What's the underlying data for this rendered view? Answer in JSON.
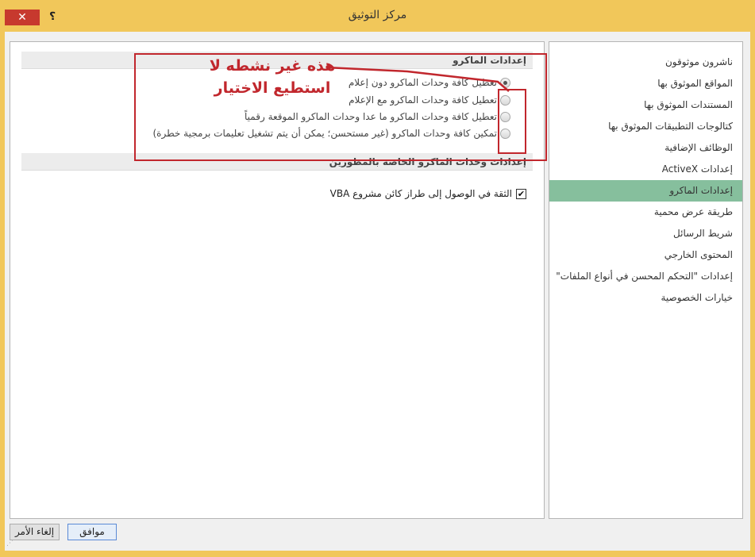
{
  "window": {
    "title": "مركز التوثيق",
    "close_glyph": "✕",
    "help_glyph": "؟"
  },
  "sidebar": {
    "items": [
      {
        "label": "ناشرون موثوقون",
        "selected": false
      },
      {
        "label": "المواقع الموثوق بها",
        "selected": false
      },
      {
        "label": "المستندات الموثوق بها",
        "selected": false
      },
      {
        "label": "كتالوجات التطبيقات الموثوق بها",
        "selected": false
      },
      {
        "label": "الوظائف الإضافية",
        "selected": false
      },
      {
        "label": "إعدادات ActiveX",
        "selected": false
      },
      {
        "label": "إعدادات الماكرو",
        "selected": true
      },
      {
        "label": "طريقة عرض محمية",
        "selected": false
      },
      {
        "label": "شريط الرسائل",
        "selected": false
      },
      {
        "label": "المحتوى الخارجي",
        "selected": false
      },
      {
        "label": "إعدادات \"التحكم المحسن في أنواع الملفات\"",
        "selected": false
      },
      {
        "label": "خيارات الخصوصية",
        "selected": false
      }
    ]
  },
  "main": {
    "macro_section_title": "إعدادات الماكرو",
    "radio_options": [
      {
        "label": "تعطيل كافة وحدات الماكرو دون إعلام",
        "checked": true
      },
      {
        "label": "تعطيل كافة وحدات الماكرو مع الإعلام",
        "checked": false
      },
      {
        "label": "تعطيل كافة وحدات الماكرو ما عدا وحدات الماكرو الموقعة رقمياً",
        "checked": false
      },
      {
        "label": "تمكين كافة وحدات الماكرو (غير مستحسن؛ يمكن أن يتم تشغيل تعليمات برمجية خطرة)",
        "checked": false
      }
    ],
    "developer_section_title": "إعدادات وحدات الماكرو الخاصة بالمطورين",
    "vba_checkbox_label": "الثقة في الوصول إلى طراز كائن مشروع VBA",
    "vba_checked": true,
    "check_glyph": "✔"
  },
  "annotation": {
    "text": "هذه غير نشطه لا\nاستطيع الاختيار",
    "color": "#c1272d"
  },
  "buttons": {
    "ok_label": "موافق",
    "cancel_label": "إلغاء الأمر"
  },
  "colors": {
    "titlebar": "#f1c75a",
    "selected_nav": "#86bf9d",
    "close_button": "#c7392e"
  }
}
